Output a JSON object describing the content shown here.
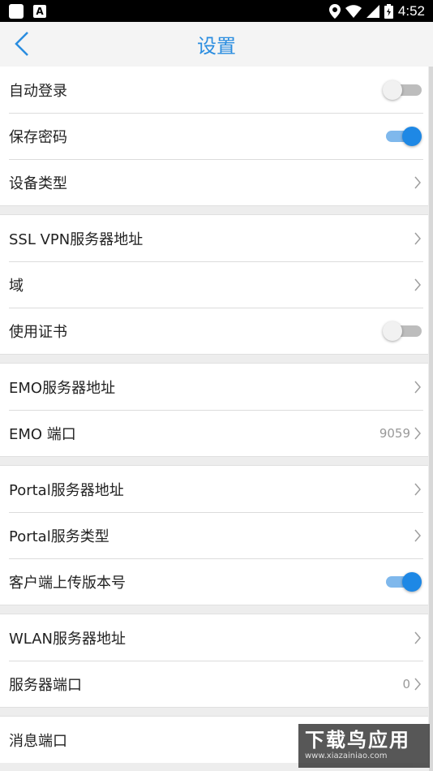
{
  "statusbar": {
    "time": "4:52"
  },
  "header": {
    "title": "设置"
  },
  "groups": [
    {
      "rows": [
        {
          "label": "自动登录",
          "control": "toggle",
          "on": false
        },
        {
          "label": "保存密码",
          "control": "toggle",
          "on": true
        },
        {
          "label": "设备类型",
          "control": "chevron"
        }
      ]
    },
    {
      "rows": [
        {
          "label": "SSL VPN服务器地址",
          "control": "chevron"
        },
        {
          "label": "域",
          "control": "chevron"
        },
        {
          "label": "使用证书",
          "control": "toggle",
          "on": false
        }
      ]
    },
    {
      "rows": [
        {
          "label": "EMO服务器地址",
          "control": "chevron"
        },
        {
          "label": "EMO 端口",
          "control": "chevron",
          "value": "9059"
        }
      ]
    },
    {
      "rows": [
        {
          "label": "Portal服务器地址",
          "control": "chevron"
        },
        {
          "label": "Portal服务类型",
          "control": "chevron"
        },
        {
          "label": "客户端上传版本号",
          "control": "toggle",
          "on": true
        }
      ]
    },
    {
      "rows": [
        {
          "label": "WLAN服务器地址",
          "control": "chevron"
        },
        {
          "label": "服务器端口",
          "control": "chevron",
          "value": "0"
        }
      ]
    },
    {
      "rows": [
        {
          "label": "消息端口",
          "control": "none"
        }
      ]
    }
  ],
  "watermark": {
    "title": "下载鸟应用",
    "url": "www.xiazainiao.com"
  },
  "colors": {
    "accent": "#1e88e5",
    "title": "#2a8de0"
  }
}
